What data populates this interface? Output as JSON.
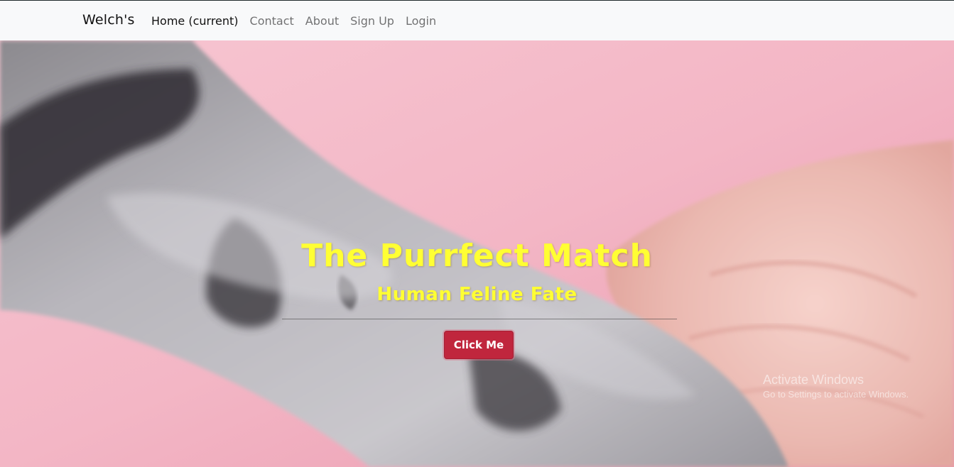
{
  "navbar": {
    "brand": "Welch's",
    "links": [
      {
        "label": "Home (current)",
        "active": true
      },
      {
        "label": "Contact",
        "active": false
      },
      {
        "label": "About",
        "active": false
      },
      {
        "label": "Sign Up",
        "active": false
      },
      {
        "label": "Login",
        "active": false
      }
    ]
  },
  "hero": {
    "title": "The Purrfect Match",
    "subtitle": "Human Feline Fate",
    "button_label": "Click Me"
  },
  "watermark": {
    "title": "Activate Windows",
    "subtitle": "Go to Settings to activate Windows."
  },
  "colors": {
    "heading": "#ffff33",
    "button": "#c0263d",
    "navbar_bg": "#f8f9fa",
    "hero_bg": "#f3b9c8"
  }
}
